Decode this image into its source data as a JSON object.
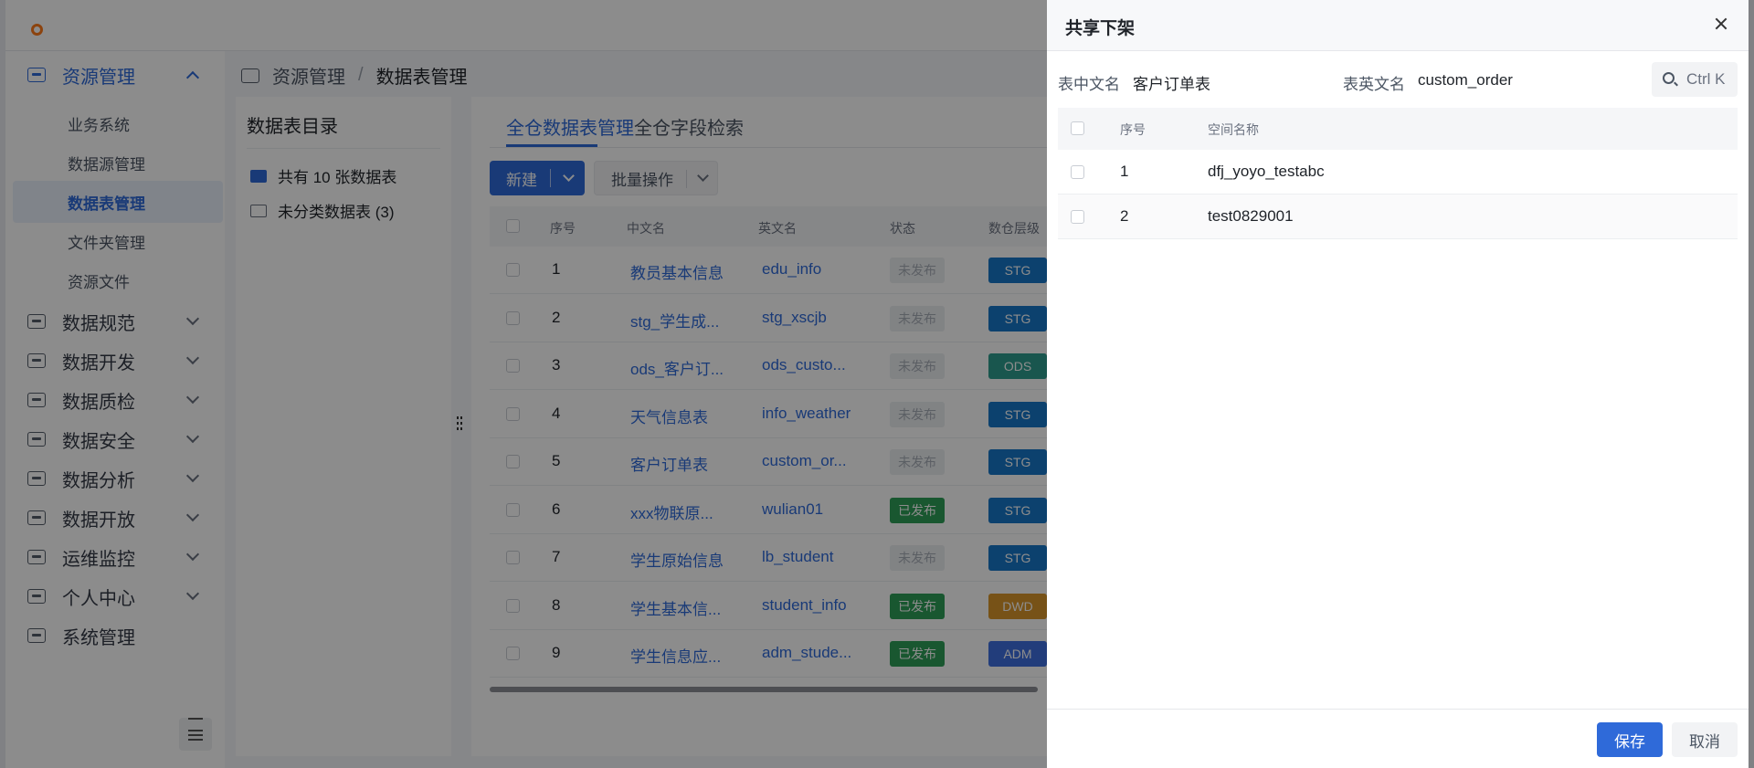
{
  "breadcrumb": [
    "资源管理",
    "数据表管理"
  ],
  "sidebar": {
    "groups": [
      {
        "label": "资源管理",
        "active": true,
        "expanded": true
      },
      {
        "label": "数据规范"
      },
      {
        "label": "数据开发"
      },
      {
        "label": "数据质检"
      },
      {
        "label": "数据安全"
      },
      {
        "label": "数据分析"
      },
      {
        "label": "数据开放"
      },
      {
        "label": "运维监控"
      },
      {
        "label": "个人中心"
      },
      {
        "label": "系统管理"
      }
    ],
    "sub_items": [
      "业务系统",
      "数据源管理",
      "数据表管理",
      "文件夹管理",
      "资源文件"
    ],
    "active_sub": "数据表管理"
  },
  "directory": {
    "title": "数据表目录",
    "items": [
      "共有 10 张数据表",
      "未分类数据表 (3)"
    ]
  },
  "main": {
    "tabs": [
      "全仓数据表管理",
      "全仓字段检索"
    ],
    "new_button": "新建",
    "batch_button": "批量操作",
    "columns": [
      "序号",
      "中文名",
      "英文名",
      "状态",
      "数仓层级"
    ],
    "rows": [
      {
        "idx": "1",
        "cn": "教员基本信息",
        "en": "edu_info",
        "status": "未发布",
        "level": "STG"
      },
      {
        "idx": "2",
        "cn": "stg_学生成...",
        "en": "stg_xscjb",
        "status": "未发布",
        "level": "STG"
      },
      {
        "idx": "3",
        "cn": "ods_客户订...",
        "en": "ods_custo...",
        "status": "未发布",
        "level": "ODS"
      },
      {
        "idx": "4",
        "cn": "天气信息表",
        "en": "info_weather",
        "status": "未发布",
        "level": "STG"
      },
      {
        "idx": "5",
        "cn": "客户订单表",
        "en": "custom_or...",
        "status": "未发布",
        "level": "STG"
      },
      {
        "idx": "6",
        "cn": "xxx物联原...",
        "en": "wulian01",
        "status": "已发布",
        "level": "STG"
      },
      {
        "idx": "7",
        "cn": "学生原始信息",
        "en": "lb_student",
        "status": "未发布",
        "level": "STG"
      },
      {
        "idx": "8",
        "cn": "学生基本信...",
        "en": "student_info",
        "status": "已发布",
        "level": "DWD"
      },
      {
        "idx": "9",
        "cn": "学生信息应...",
        "en": "adm_stude...",
        "status": "已发布",
        "level": "ADM"
      }
    ]
  },
  "drawer": {
    "title": "共享下架",
    "cn_label": "表中文名",
    "cn_value": "客户订单表",
    "en_label": "表英文名",
    "en_value": "custom_order",
    "search_placeholder": "Ctrl K",
    "columns": [
      "序号",
      "空间名称"
    ],
    "rows": [
      {
        "idx": "1",
        "name": "dfj_yoyo_testabc"
      },
      {
        "idx": "2",
        "name": "test0829001"
      }
    ],
    "save": "保存",
    "cancel": "取消"
  },
  "colors": {
    "accent": "#2f6ad9",
    "published": "#2f9e58"
  }
}
